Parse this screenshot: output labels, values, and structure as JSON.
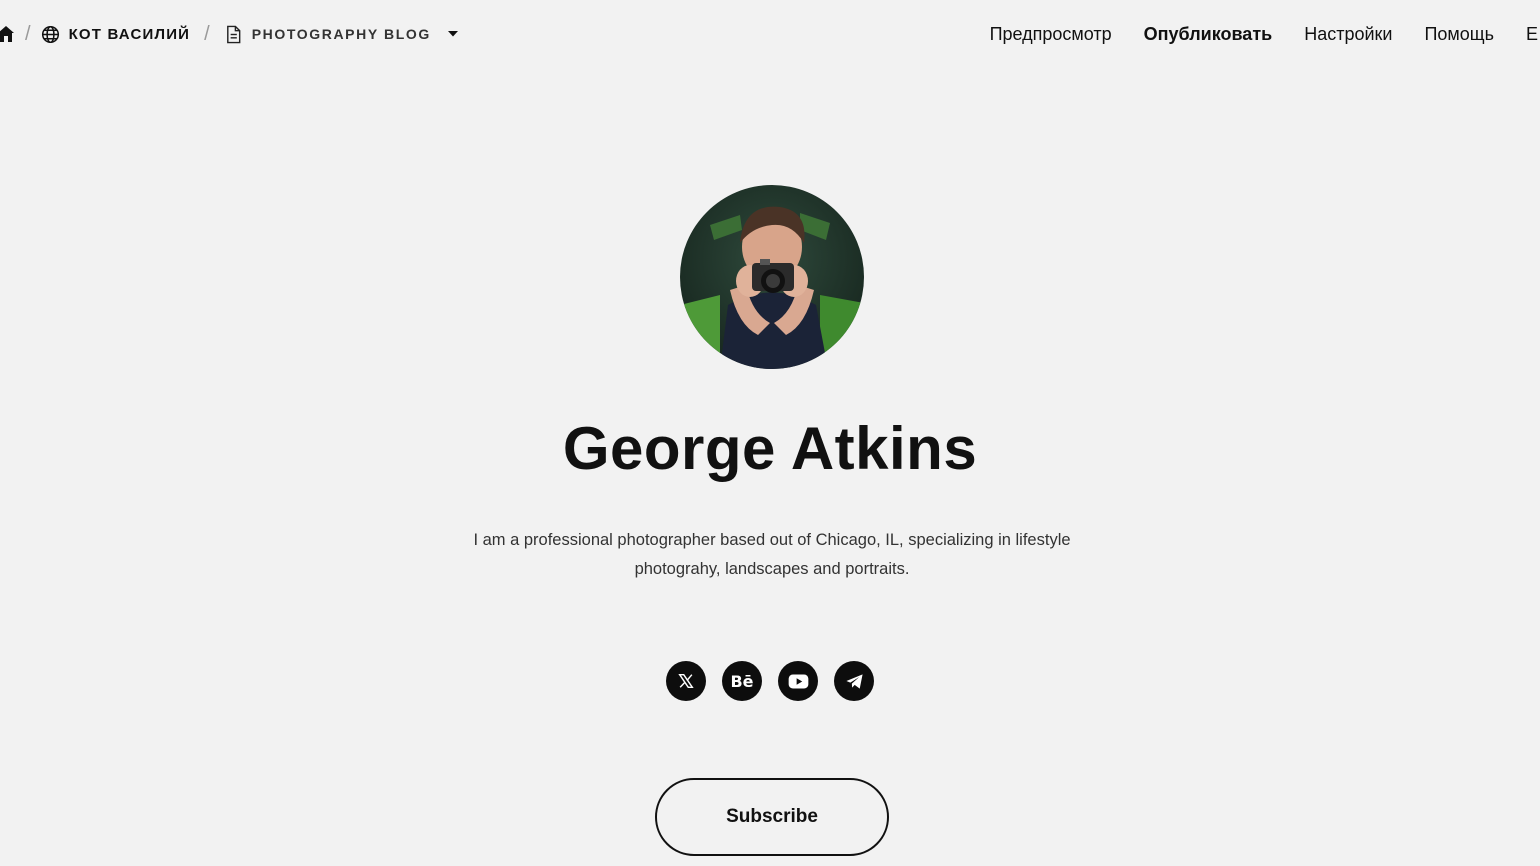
{
  "breadcrumb": {
    "site": "КОТ ВАСИЛИЙ",
    "page": "PHOTOGRAPHY BLOG"
  },
  "nav": {
    "preview": "Предпросмотр",
    "publish": "Опубликовать",
    "settings": "Настройки",
    "help": "Помощь",
    "more": "Е"
  },
  "profile": {
    "name": "George Atkins",
    "bio": "I am a professional photographer based out of Chicago, IL, specializing in lifestyle photograhy, landscapes and portraits."
  },
  "socials": {
    "behance_label": "Bē"
  },
  "subscribe_label": "Subscribe",
  "colors": {
    "background": "#f2f2f2",
    "text": "#111111",
    "icon_bg": "#0d0d0d"
  },
  "icons": [
    "home-icon",
    "globe-icon",
    "document-icon",
    "caret-down-icon",
    "x-icon",
    "behance-icon",
    "youtube-icon",
    "telegram-icon"
  ]
}
